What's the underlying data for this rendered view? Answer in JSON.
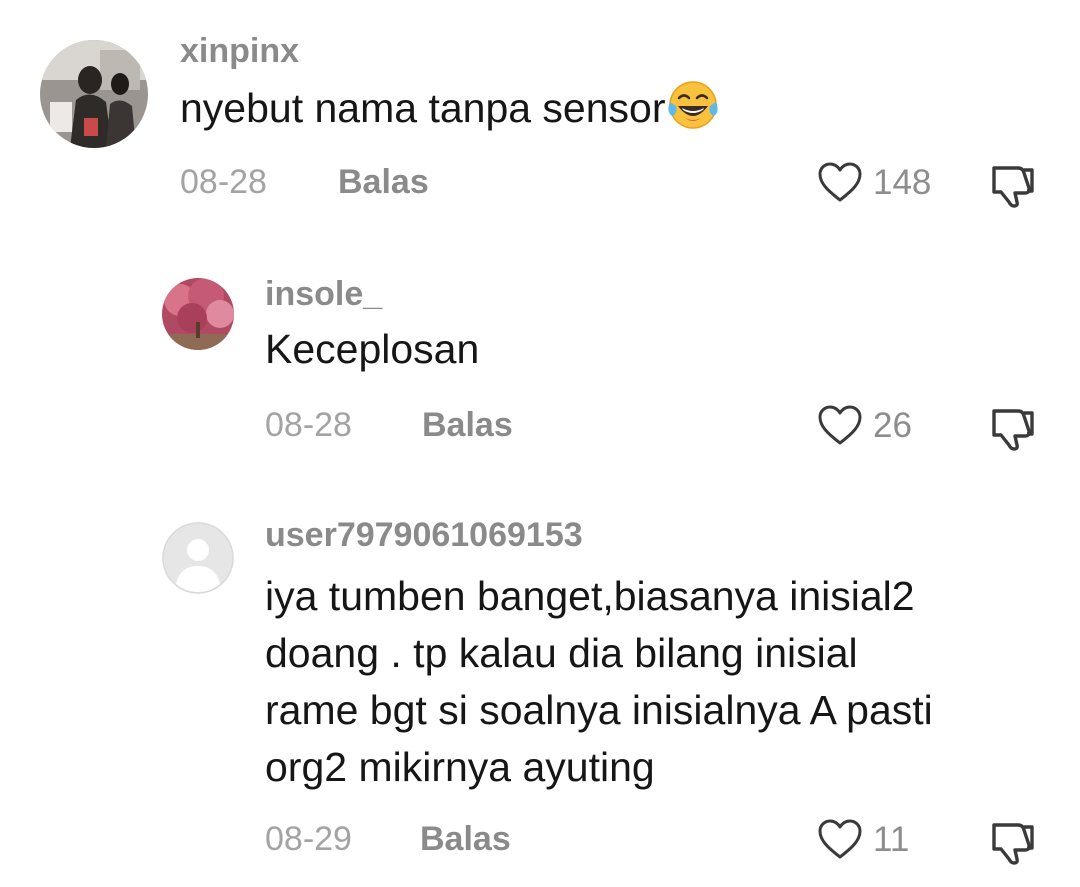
{
  "comments": [
    {
      "username": "xinpinx",
      "text_lines": [
        "nyebut nama tanpa sensor"
      ],
      "emoji": "face-with-tears-of-joy",
      "date": "08-28",
      "reply_label": "Balas",
      "likes": "148"
    },
    {
      "username": "insole_",
      "text_lines": [
        "Keceplosan"
      ],
      "date": "08-28",
      "reply_label": "Balas",
      "likes": "26"
    },
    {
      "username": "user7979061069153",
      "text_lines": [
        "iya tumben banget,biasanya inisial2",
        "doang . tp kalau dia bilang inisial",
        "rame bgt si soalnya inisialnya A pasti",
        "org2 mikirnya ayuting"
      ],
      "date": "08-29",
      "reply_label": "Balas",
      "likes": "11"
    }
  ],
  "icons": {
    "like": "heart-outline-icon",
    "dislike": "thumbs-down-icon",
    "default_avatar": "default-user-avatar"
  },
  "colors": {
    "username": "#8a8a8a",
    "meta": "#a3a3a3",
    "text": "#161616",
    "icon": "#3a3a3a"
  }
}
